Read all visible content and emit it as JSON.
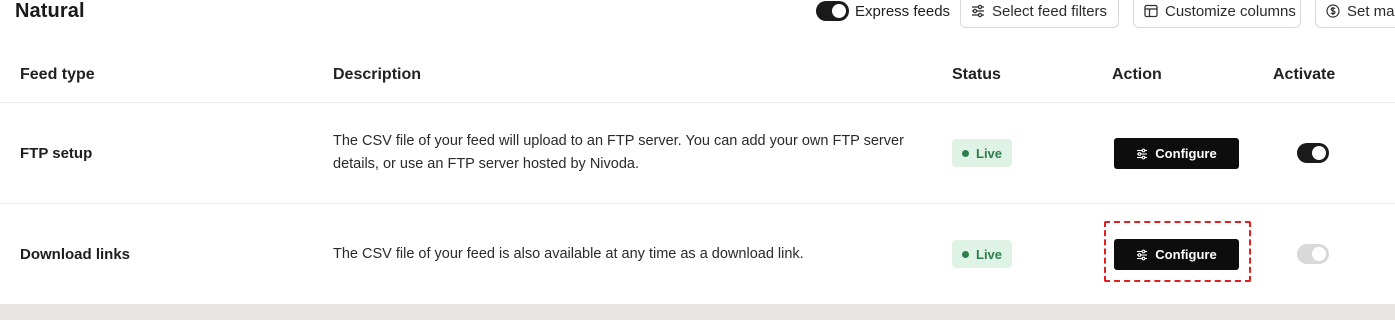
{
  "page": {
    "title": "Natural"
  },
  "toolbar": {
    "express_label": "Express feeds",
    "express_on": true,
    "filters_label": "Select feed filters",
    "columns_label": "Customize columns",
    "setmarkup_label": "Set ma"
  },
  "table": {
    "headers": [
      "Feed type",
      "Description",
      "Status",
      "Action",
      "Activate"
    ],
    "rows": [
      {
        "feed_type": "FTP setup",
        "description": "The CSV file of your feed will upload to an FTP server. You can add your own FTP server details, or use an FTP server hosted by Nivoda.",
        "status": "Live",
        "action": "Configure",
        "activate": true
      },
      {
        "feed_type": "Download links",
        "description": "The CSV file of your feed is also available at any time as a download link.",
        "status": "Live",
        "action": "Configure",
        "activate": false
      }
    ]
  },
  "colors": {
    "status_live_bg": "#dff2e6",
    "status_live_fg": "#2e7d4c",
    "highlight": "#e02020"
  },
  "icons": {
    "filters": "sliders-icon",
    "columns": "table-columns-icon",
    "setmarkup": "dollar-circle-icon",
    "configure": "sliders-icon"
  }
}
